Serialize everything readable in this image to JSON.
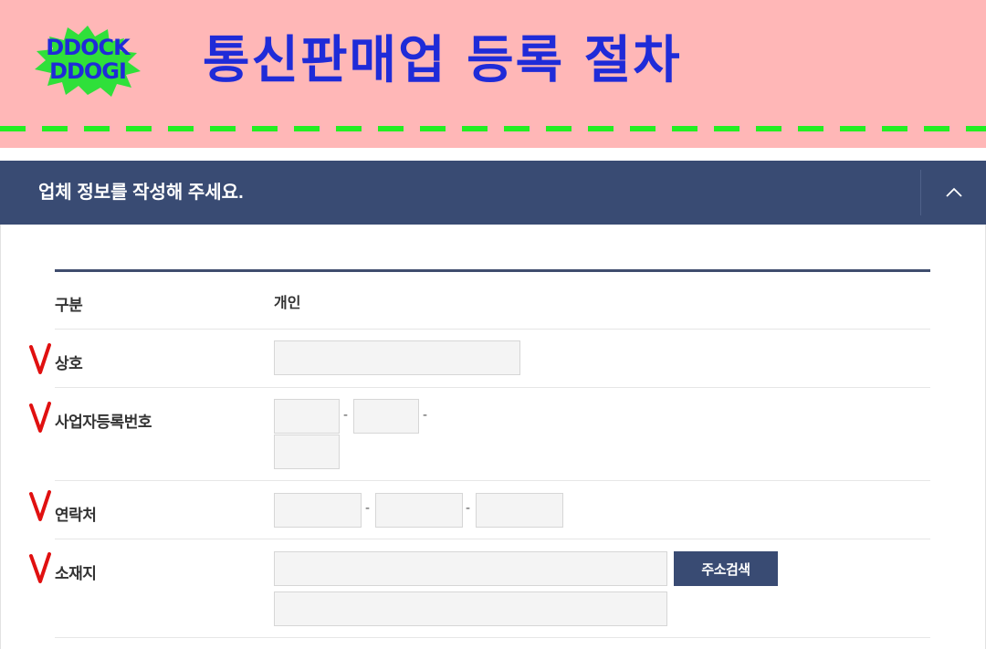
{
  "banner": {
    "logo_line1": "DDOCK",
    "logo_line2": "DDOGI",
    "title": "통신판매업 등록 절차",
    "colors": {
      "background": "#ffb7b7",
      "title": "#1f2bd8",
      "dash": "#22ee22",
      "logo_burst": "#2fe03a"
    }
  },
  "section": {
    "title": "업체 정보를 작성해 주세요.",
    "collapse_icon": "chevron-up-icon",
    "color": "#394b73"
  },
  "form": {
    "type": {
      "label": "구분",
      "value": "개인"
    },
    "company_name": {
      "label": "상호",
      "value": ""
    },
    "business_number": {
      "label": "사업자등록번호",
      "separator": "-",
      "values": [
        "",
        "",
        ""
      ]
    },
    "phone": {
      "label": "연락처",
      "separator": "-",
      "values": [
        "",
        "",
        ""
      ]
    },
    "address": {
      "label": "소재지",
      "search_button": "주소검색",
      "values": [
        "",
        ""
      ]
    },
    "required_mark": "check-mark-icon"
  }
}
